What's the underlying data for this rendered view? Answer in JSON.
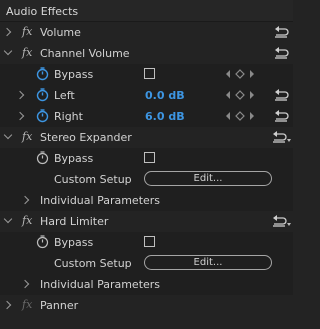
{
  "panel": {
    "title": "Audio Effects"
  },
  "effects": {
    "volume": {
      "fx": "fx",
      "name": "Volume"
    },
    "channel_volume": {
      "fx": "fx",
      "name": "Channel Volume",
      "bypass": "Bypass",
      "left": {
        "name": "Left",
        "value": "0.0 dB"
      },
      "right": {
        "name": "Right",
        "value": "6.0 dB"
      }
    },
    "stereo_expander": {
      "fx": "fx",
      "name": "Stereo Expander",
      "bypass": "Bypass",
      "custom_setup": "Custom Setup",
      "edit": "Edit...",
      "individual": "Individual Parameters"
    },
    "hard_limiter": {
      "fx": "fx",
      "name": "Hard Limiter",
      "bypass": "Bypass",
      "custom_setup": "Custom Setup",
      "edit": "Edit...",
      "individual": "Individual Parameters"
    },
    "panner": {
      "fx": "fx",
      "name": "Panner"
    }
  },
  "colors": {
    "value_blue": "#3d96e3",
    "panel_bg": "#232323"
  },
  "icons": {
    "reset": "reset-icon",
    "stopwatch": "stopwatch-icon",
    "keyframe": "keyframe-nav-icon"
  }
}
